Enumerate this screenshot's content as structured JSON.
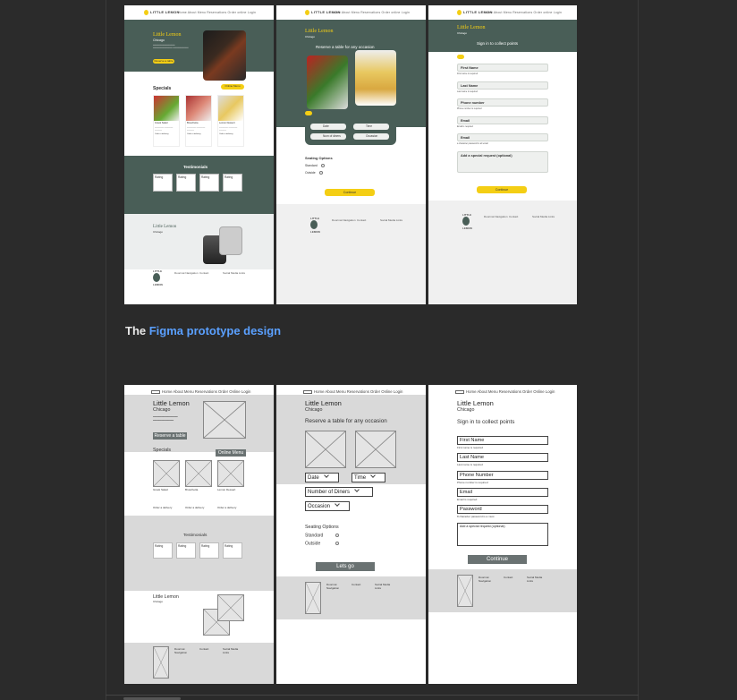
{
  "caption": {
    "prefix": "The ",
    "link": "Figma prototype design"
  },
  "hifi": {
    "nav_logo": "LITTLE LEMON",
    "nav_links": "Home About Menu Reservations Order online Login",
    "brand_title": "Little Lemon",
    "brand_city": "Chicago",
    "reserve_btn": "Reserve a table",
    "specials_title": "Specials",
    "online_menu_btn": "Online Menu",
    "dish_names": [
      "Greek Salad",
      "Bruschetta",
      "Lemon Dessert"
    ],
    "order_delivery": "Order a delivery",
    "testimonials_title": "Testimonials",
    "rating_label": "Rating",
    "reserve_heading": "Reserve a table for any occasion",
    "date_label": "Date",
    "time_label": "Time",
    "diners_label": "Num of diners",
    "occasion_label": "Occasion",
    "seating_title": "Seating Options",
    "standard": "Standard",
    "outside": "Outside",
    "continue": "Continue",
    "signin_heading": "Sign in to collect points",
    "fields": [
      {
        "label": "First Name",
        "hint": "First name is required"
      },
      {
        "label": "Last Name",
        "hint": "Last name is required"
      },
      {
        "label": "Phone number",
        "hint": "Phone number is required"
      },
      {
        "label": "Email",
        "hint": "Email is required"
      },
      {
        "label": "Email",
        "hint": "a character password is all email"
      }
    ],
    "special_request": "Add a special request (optional)",
    "footer_logo_top": "LITTLE",
    "footer_logo_bottom": "LEMON",
    "footer_cols": [
      "Doormat Navigation",
      "Contact",
      "Social Media Links"
    ]
  },
  "wire": {
    "nav_links": "Home About Menu Reservations Order Online Login",
    "brand_title": "Little Lemon",
    "brand_city": "Chicago",
    "reserve_btn": "Reserve a table",
    "specials": "Specials",
    "online_menu": "Online Menu",
    "dish_row": [
      "Greek Salad",
      "Bruschetta",
      "Lemon Dessert"
    ],
    "order_delivery": "Order a delivery",
    "testimonials": "Testimonials",
    "rating": "Rating",
    "reserve_heading": "Reserve a table for any occasion",
    "date": "Date",
    "time": "Time",
    "diners": "Number of Diners",
    "occasion": "Occasion",
    "seating": "Seating Options",
    "standard": "Standard",
    "outside": "Outside",
    "lets_go": "Lets go",
    "signin_heading": "Sign in to collect points",
    "first_name": "First Name",
    "first_hint": "First name is required",
    "last_name": "Last Name",
    "last_hint": "Last name is required",
    "phone": "Phone Number",
    "phone_hint": "Phone number is required",
    "email": "Email",
    "email_hint": "Email is required",
    "password": "Password",
    "password_hint": "8 character password is a must",
    "special": "Add a special request (optional)",
    "continue": "Continue",
    "footer_cols": [
      "Doormat Navigation",
      "Contact",
      "Social Media Links"
    ]
  }
}
